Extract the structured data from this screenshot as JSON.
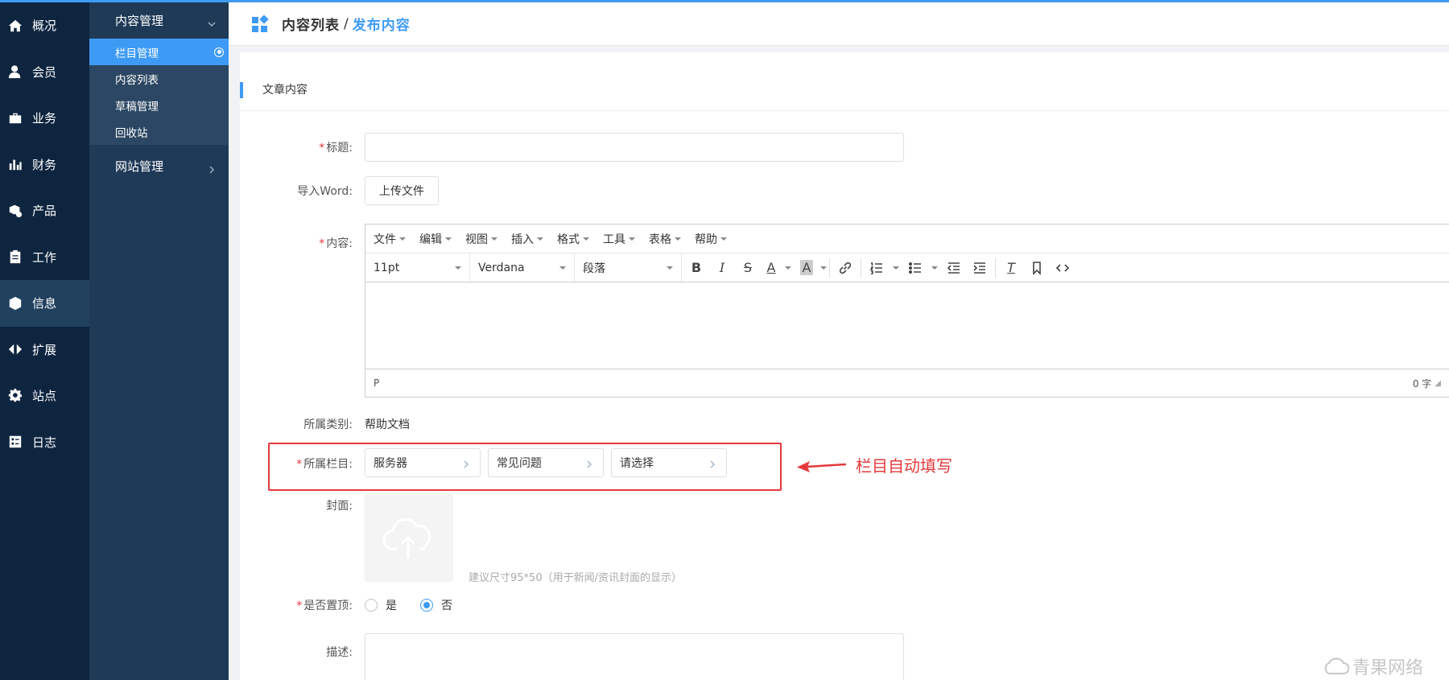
{
  "nav_primary": [
    {
      "label": "概况",
      "icon": "home-icon"
    },
    {
      "label": "会员",
      "icon": "user-icon"
    },
    {
      "label": "业务",
      "icon": "briefcase-icon"
    },
    {
      "label": "财务",
      "icon": "bar-chart-icon"
    },
    {
      "label": "产品",
      "icon": "products-icon"
    },
    {
      "label": "工作",
      "icon": "clipboard-icon"
    },
    {
      "label": "信息",
      "icon": "cube-icon",
      "active": true
    },
    {
      "label": "扩展",
      "icon": "arrows-icon"
    },
    {
      "label": "站点",
      "icon": "gear-icon"
    },
    {
      "label": "日志",
      "icon": "log-icon"
    }
  ],
  "nav_secondary": {
    "group1": "内容管理",
    "items": [
      "栏目管理",
      "内容列表",
      "草稿管理",
      "回收站"
    ],
    "group2": "网站管理"
  },
  "header": {
    "crumb1": "内容列表",
    "sep": "/",
    "crumb2": "发布内容"
  },
  "section": {
    "title": "文章内容"
  },
  "form": {
    "required_mark": "*",
    "title_label": "标题:",
    "word_label": "导入Word:",
    "upload_file_btn": "上传文件",
    "content_label": "内容:",
    "category_label": "所属类别:",
    "category_value": "帮助文档",
    "column_label": "所属栏目:",
    "column_values": [
      "服务器",
      "常见问题",
      "请选择"
    ],
    "cover_label": "封面:",
    "cover_hint": "建议尺寸95*50（用于新闻/资讯封面的显示）",
    "top_label": "是否置顶:",
    "top_yes": "是",
    "top_no": "否",
    "desc_label": "描述:"
  },
  "editor": {
    "menus": [
      "文件",
      "编辑",
      "视图",
      "插入",
      "格式",
      "工具",
      "表格",
      "帮助"
    ],
    "font_size": "11pt",
    "font_family": "Verdana",
    "block": "段落",
    "status_path": "P",
    "word_count": "0 字"
  },
  "annotation": "栏目自动填写",
  "watermark": "青果网络",
  "colors": {
    "accent": "#3e9bf5",
    "sidebar": "#0e2540",
    "danger": "#e4393c"
  }
}
